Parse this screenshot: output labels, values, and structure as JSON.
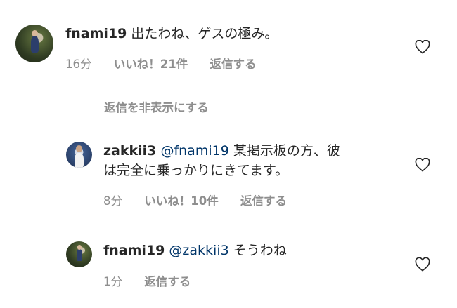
{
  "comments": [
    {
      "username": "fnami19",
      "mention": "",
      "text": "出たわね、ゲスの極み。",
      "time": "16分",
      "likes": "いいね！21件",
      "reply": "返信する"
    },
    {
      "username": "zakkii3",
      "mention": "@fnami19",
      "text_line1": "某掲示板の方、彼",
      "text_line2": "は完全に乗っかりにきてます。",
      "time": "8分",
      "likes": "いいね！10件",
      "reply": "返信する"
    },
    {
      "username": "fnami19",
      "mention": "@zakkii3",
      "text": "そうわね",
      "time": "1分",
      "reply": "返信する"
    }
  ],
  "hide_replies": "返信を非表示にする",
  "icons": {
    "like": "heart-icon"
  }
}
